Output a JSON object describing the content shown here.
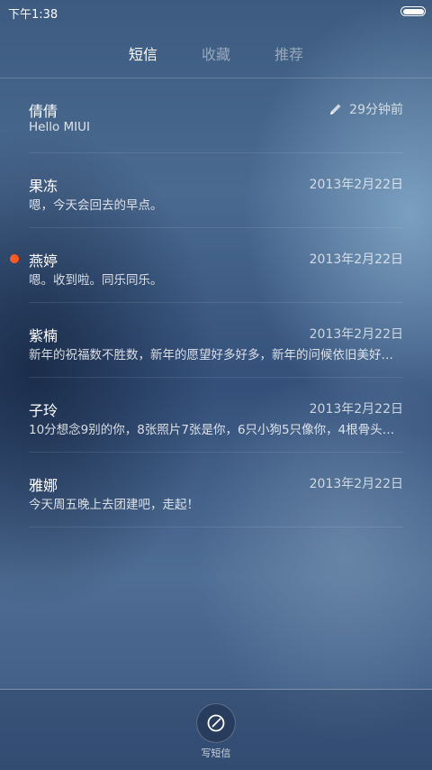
{
  "status_bar": {
    "time": "下午1:38",
    "battery_icon": "battery-full-icon"
  },
  "tabs": [
    {
      "label": "短信",
      "active": true
    },
    {
      "label": "收藏",
      "active": false
    },
    {
      "label": "推荐",
      "active": false
    }
  ],
  "messages": [
    {
      "name": "倩倩",
      "time": "29分钟前",
      "preview": "Hello MIUI",
      "draft": true,
      "unread": false
    },
    {
      "name": "果冻",
      "time": "2013年2月22日",
      "preview": "嗯，今天会回去的早点。",
      "draft": false,
      "unread": false
    },
    {
      "name": "燕婷",
      "time": "2013年2月22日",
      "preview": "嗯。收到啦。同乐同乐。",
      "draft": false,
      "unread": true
    },
    {
      "name": "紫楠",
      "time": "2013年2月22日",
      "preview": "新年的祝福数不胜数，新年的愿望好多好多，新年的问候依旧美好…",
      "draft": false,
      "unread": false
    },
    {
      "name": "子玲",
      "time": "2013年2月22日",
      "preview": "10分想念9别的你，8张照片7张是你，6只小狗5只像你，4根骨头…",
      "draft": false,
      "unread": false
    },
    {
      "name": "雅娜",
      "time": "2013年2月22日",
      "preview": "今天周五晚上去团建吧，走起！",
      "draft": false,
      "unread": false
    }
  ],
  "bottom_bar": {
    "compose_label": "写短信",
    "compose_icon": "compose-pen-icon"
  },
  "colors": {
    "unread_dot": "#ff5a1f",
    "background_top": "#3d5b80",
    "background_bottom": "#3a5680"
  }
}
